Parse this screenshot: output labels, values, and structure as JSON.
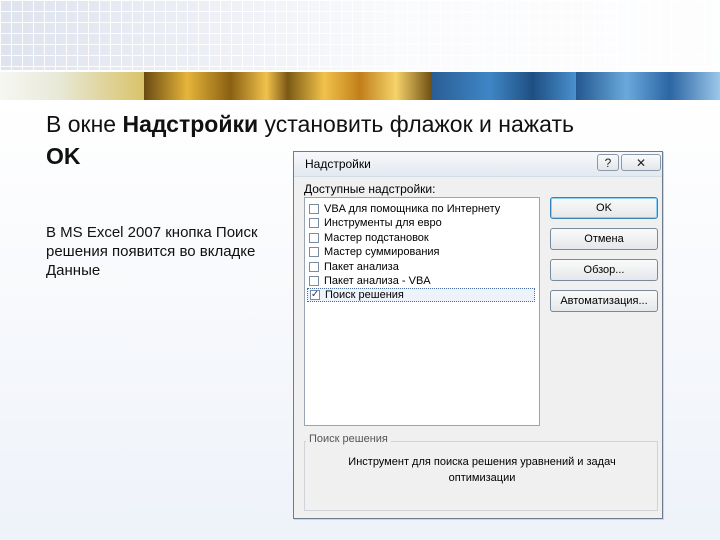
{
  "slide": {
    "heading_part1": "В окне ",
    "heading_bold1": "Надстройки",
    "heading_part2": " установить флажок и нажать ",
    "heading_bold2": "OK",
    "note": "В MS Excel 2007 кнопка Поиск решения появится во вкладке Данные"
  },
  "dialog": {
    "title": "Надстройки",
    "help_glyph": "?",
    "close_glyph": "✕",
    "available_label": "Доступные надстройки:",
    "items": [
      {
        "label": "VBA для помощника по Интернету",
        "checked": false
      },
      {
        "label": "Инструменты для евро",
        "checked": false
      },
      {
        "label": "Мастер подстановок",
        "checked": false
      },
      {
        "label": "Мастер суммирования",
        "checked": false
      },
      {
        "label": "Пакет анализа",
        "checked": false
      },
      {
        "label": "Пакет анализа - VBA",
        "checked": false
      },
      {
        "label": "Поиск решения",
        "checked": true,
        "selected": true
      }
    ],
    "buttons": {
      "ok": "OK",
      "cancel": "Отмена",
      "browse": "Обзор...",
      "automation": "Автоматизация..."
    },
    "group": {
      "title": "Поиск решения",
      "description": "Инструмент для поиска решения уравнений и задач оптимизации"
    },
    "check_glyph": "✓"
  },
  "colors": {
    "accent": "#3c7fb1",
    "dialog_bg": "#f0f0f0"
  }
}
